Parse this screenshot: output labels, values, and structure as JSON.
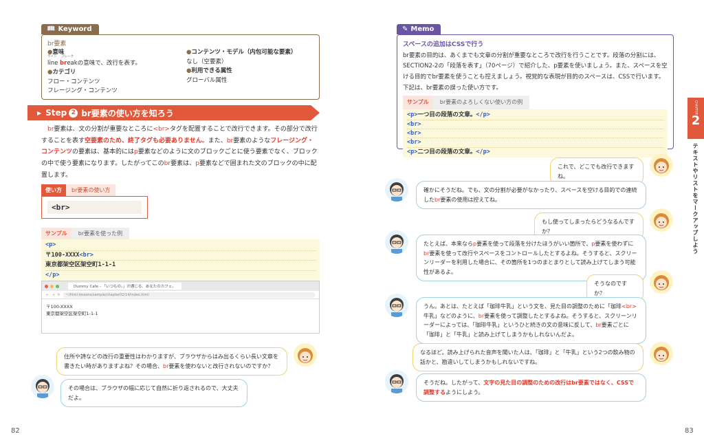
{
  "left": {
    "keyword": {
      "tag": "Keyword",
      "title": "br要素",
      "meaning_label": "意味",
      "ruby_line": "ライン",
      "ruby_break": "ブレーク",
      "meaning_text_pre": "line ",
      "meaning_break_br": "br",
      "meaning_break_rest": "eak",
      "meaning_text_post": "の意味で、改行を表す。",
      "category_label": "カテゴリ",
      "category_1": "フロー・コンテンツ",
      "category_2": "フレージング・コンテンツ",
      "content_model_label": "コンテンツ・モデル（内包可能な要素）",
      "content_model_value": "なし（空要素）",
      "attrs_label": "利用できる属性",
      "attrs_value": "グローバル属性"
    },
    "step": {
      "label": "Step",
      "num": "2",
      "title": "br要素の使い方を知ろう"
    },
    "para": {
      "s1": "br",
      "s2": "要素は、文の分割が重要なところに",
      "s3": "<br>",
      "s4": "タグを配置することで改行できます。その部分で改行する",
      "s5": "ことを表す",
      "s6": "空要素のため、終了タグも必要ありません",
      "s7": "。また、",
      "s8": "br",
      "s9": "要素のような",
      "s10": "フレージング・コンテン",
      "s11": "ツ",
      "s12": "の要素は、基本的には",
      "s13": "p",
      "s14": "要素などのように文のブロックごとに使う要素でなく、ブロックの中で使う要",
      "s15": "素になります。したがってこの",
      "s16": "br",
      "s17": "要素は、",
      "s18": "p",
      "s19": "要素などで囲まれた文のブロックの中に配置します。"
    },
    "usage": {
      "tag": "使い方",
      "sub": "br要素の使い方",
      "code": "<br>"
    },
    "sample": {
      "tag": "サンプル",
      "sub": "br要素を使った例",
      "line1": "<p>",
      "line2_pre": "〒100-XXXX",
      "line2_tag": "<br>",
      "line3": "東京都架空区架空町1-1-1",
      "line4": "</p>"
    },
    "browser": {
      "tab": "Dummy Cafe - 「いつもの。」が通じる、あなたのカフェ。",
      "url": "~/html-lessons/sample/chapter02/14/index.html",
      "line1": "〒100-XXXX",
      "line2": "東京都架空区架空町1-1-1"
    },
    "dialog1": {
      "pre": "住所や詩などの改行の重要性はわかりますが、ブラウザからはみ出るくらい長い文章を書きたい時がありますよね？その場合、",
      "br": "br",
      "post": "要素を使わないと改行されないのですか？"
    },
    "dialog2": "その場合は、ブラウザの幅に応じて自然に折り返されるので、大丈夫だよ。",
    "page_number": "82"
  },
  "right": {
    "memo": {
      "tag": "Memo",
      "title": "スペースの追加はCSSで行う",
      "text": "br要素の目的は、あくまでも文章の分割が重要なところで改行を行うことです。段落の分割には、SECTION2-2の「段落を表す」（70ページ）で紹介した、p要素を使いましょう。また、スペースを空ける目的でbr要素を使うことも控えましょう。視覚的な表現が目的のスペースは、CSSで行います。下記は、br要素の誤った使い方です。",
      "sample_tag": "サンプル",
      "sample_sub": "br要素のよろしくない使い方の例",
      "c1_open": "<p>",
      "c1_text": "一つ目の段落の文章。",
      "c1_close": "</p>",
      "c_br": "<br>",
      "c5_open": "<p>",
      "c5_text": "二つ目の段落の文章。",
      "c5_close": "</p>"
    },
    "dialogs": [
      {
        "text": "これで、どこでも改行できますね。"
      },
      {
        "pre": "確かにそうだね。でも、文の分割が必要がなかったり、スペースを空ける目的での連続した",
        "br": "br",
        "post": "要素の使用は控えてね。"
      },
      {
        "text": "もし使ってしまったらどうなるんですか？"
      },
      {
        "a": "たとえば、本来なら",
        "b": "p",
        "c": "要素を使って段落を分けたほうがいい箇所で、",
        "d": "p",
        "e": "要素を使わずに",
        "f": "br",
        "g": "要素を使って改行やスペースをコントロールしたとするよね。そうすると、スクリーンリーダーを利用した場合に、その箇所を1つのまとまりとして読み上げてしまう可能性があるよ。"
      },
      {
        "text": "そうなのですか？"
      },
      {
        "a": "うん。あとは、たとえば「珈琲牛乳」という文を、見た目の調整のために「珈琲",
        "b": "<br>",
        "c": "牛乳」などのように、",
        "d": "br",
        "e": "要素を使って調整したとするよね。そうすると、スクリーンリーダーによっては、「珈琲牛乳」というひと続きの文の意味に反して、",
        "f": "br",
        "g": "要素ごとに「珈琲」と「牛乳」と読み上げてしまうかもしれないんだよ。"
      },
      {
        "text": "なるほど。読み上げられた音声を聞いた人は、「珈琲」と「牛乳」という2つの飲み物の話かと、勘違いしてしまうかもしれないですね。"
      },
      {
        "pre": "そうだね。したがって、",
        "red": "文字の見た目の調整のための改行はbr要素ではなく、CSSで調整する",
        "post": "ようにしよう。"
      }
    ],
    "chapter_label": "CHAPTER",
    "chapter_num": "2",
    "chapter_title": "テキストやリストをマークアップしよう",
    "page_number": "83"
  },
  "colors": {
    "accent": "#e2583a",
    "keyword": "#8a6d4d",
    "memo": "#6a55a3",
    "bubble_blue": "#9ed0e8",
    "bubble_yellow": "#f3d26a"
  }
}
